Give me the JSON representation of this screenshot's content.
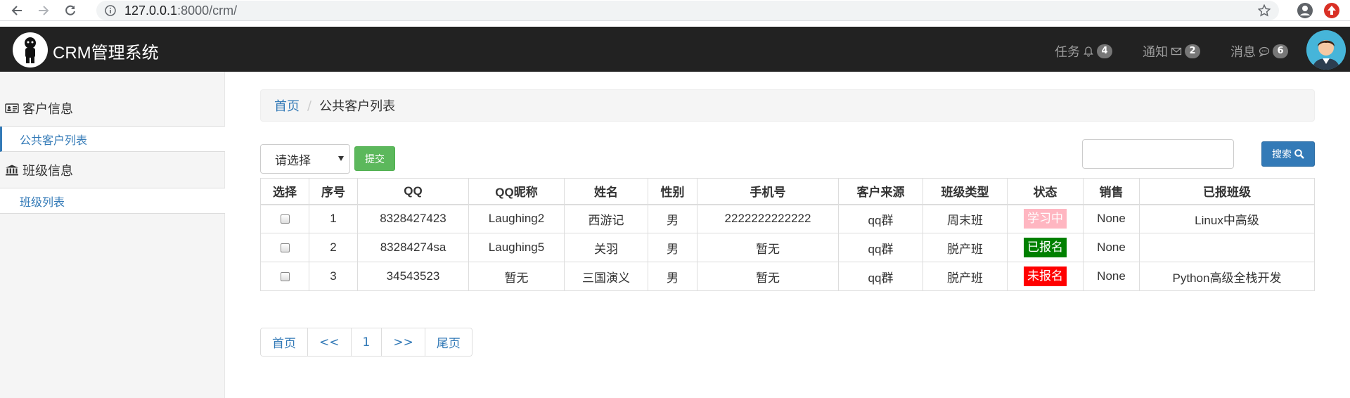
{
  "browser": {
    "url_host": "127.0.0.1",
    "url_rest": ":8000/crm/"
  },
  "navbar": {
    "brand": "CRM管理系统",
    "items": [
      {
        "label": "任务",
        "count": "4",
        "icon": "bell-icon"
      },
      {
        "label": "通知",
        "count": "2",
        "icon": "envelope-icon"
      },
      {
        "label": "消息",
        "count": "6",
        "icon": "comment-icon"
      }
    ]
  },
  "sidebar": {
    "groups": [
      {
        "label": "客户信息",
        "icon": "id-card-icon",
        "links": [
          {
            "label": "公共客户列表",
            "active": true
          }
        ]
      },
      {
        "label": "班级信息",
        "icon": "bank-icon",
        "links": [
          {
            "label": "班级列表",
            "active": false
          }
        ]
      }
    ]
  },
  "breadcrumb": {
    "home": "首页",
    "current": "公共客户列表"
  },
  "filter": {
    "select_value": "请选择",
    "submit_label": "提交"
  },
  "search": {
    "value": "",
    "button_label": "搜索"
  },
  "table": {
    "headers": [
      "选择",
      "序号",
      "QQ",
      "QQ昵称",
      "姓名",
      "性别",
      "手机号",
      "客户来源",
      "班级类型",
      "状态",
      "销售",
      "已报班级"
    ],
    "rows": [
      {
        "index": "1",
        "qq": "8328427423",
        "nickname": "Laughing2",
        "name": "西游记",
        "gender": "男",
        "phone": "2222222222222",
        "source": "qq群",
        "class_type": "周末班",
        "status": "学习中",
        "status_color": "#ffb6c1",
        "sales": "None",
        "enrolled": "Linux中高级"
      },
      {
        "index": "2",
        "qq": "83284274sa",
        "nickname": "Laughing5",
        "name": "关羽",
        "gender": "男",
        "phone": "暂无",
        "source": "qq群",
        "class_type": "脱产班",
        "status": "已报名",
        "status_color": "#008000",
        "sales": "None",
        "enrolled": ""
      },
      {
        "index": "3",
        "qq": "34543523",
        "nickname": "暂无",
        "name": "三国演义",
        "gender": "男",
        "phone": "暂无",
        "source": "qq群",
        "class_type": "脱产班",
        "status": "未报名",
        "status_color": "#ff0000",
        "sales": "None",
        "enrolled": "Python高级全栈开发"
      }
    ]
  },
  "pagination": {
    "items": [
      "首页",
      "<<",
      "1",
      ">>",
      "尾页"
    ]
  },
  "colors": {
    "navbar_bg": "#222222",
    "link": "#337ab7",
    "success": "#5cb85c",
    "primary": "#337ab7"
  }
}
